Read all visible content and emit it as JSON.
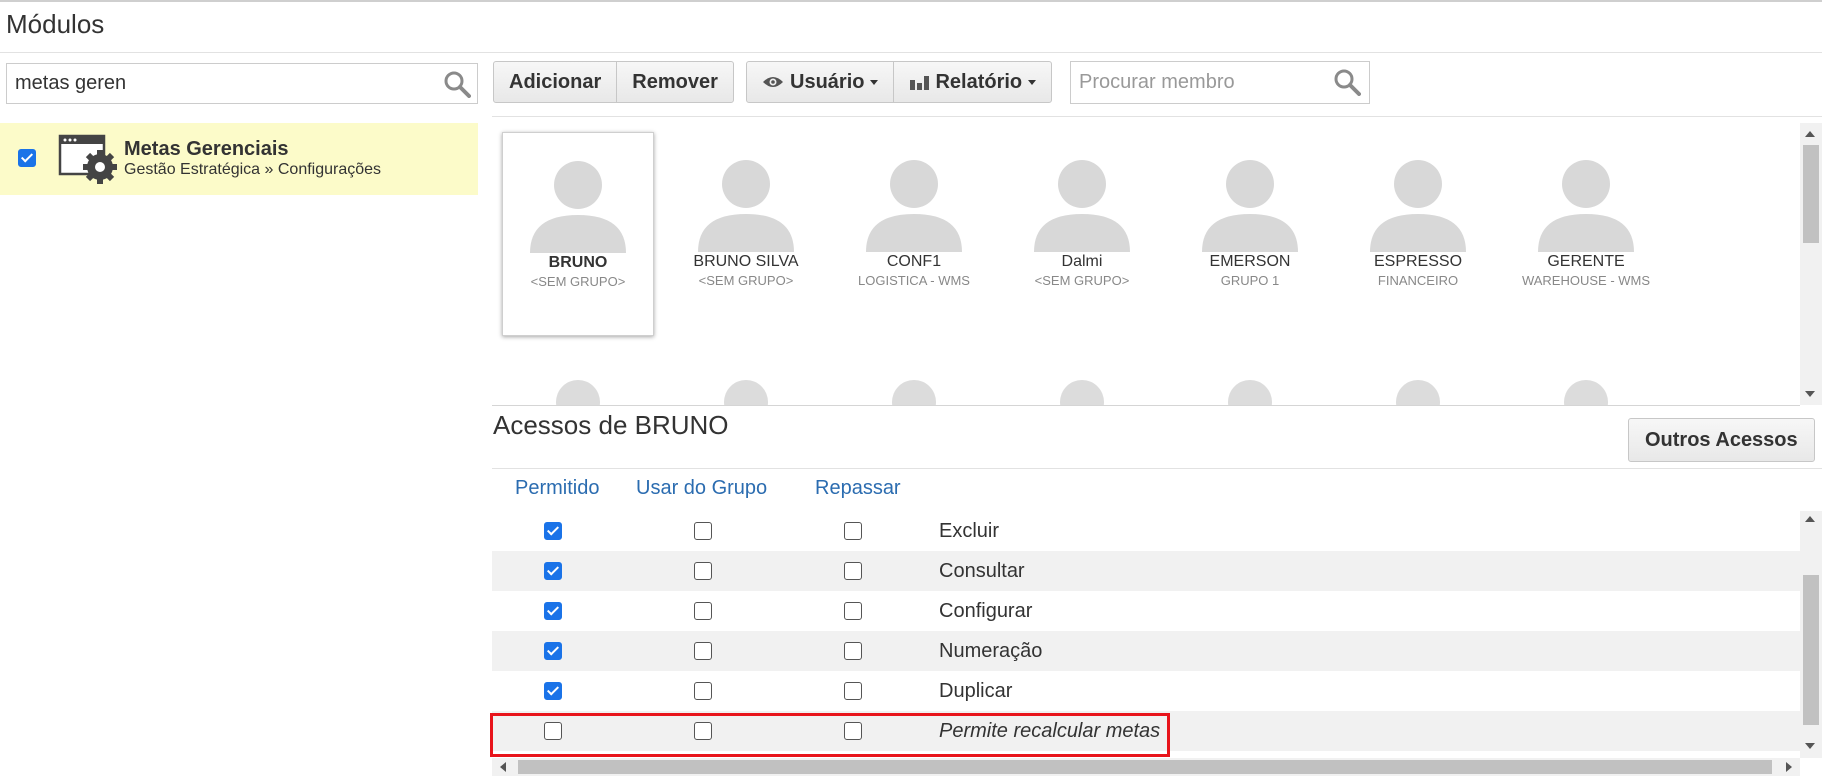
{
  "page_title": "Módulos",
  "module_search": {
    "value": "metas geren",
    "icon": "search-icon"
  },
  "module": {
    "name": "Metas Gerenciais",
    "path": "Gestão Estratégica » Configurações",
    "checked": true,
    "icon": "window-gear-icon"
  },
  "toolbar": {
    "add_label": "Adicionar",
    "remove_label": "Remover",
    "user_label": "Usuário",
    "report_label": "Relatório",
    "member_search_placeholder": "Procurar membro"
  },
  "members": [
    {
      "name": "BRUNO",
      "group": "<SEM GRUPO>",
      "selected": true
    },
    {
      "name": "BRUNO SILVA",
      "group": "<SEM GRUPO>",
      "selected": false
    },
    {
      "name": "CONF1",
      "group": "LOGISTICA - WMS",
      "selected": false
    },
    {
      "name": "Dalmi",
      "group": "<SEM GRUPO>",
      "selected": false
    },
    {
      "name": "EMERSON",
      "group": "GRUPO 1",
      "selected": false
    },
    {
      "name": "ESPRESSO",
      "group": "FINANCEIRO",
      "selected": false
    },
    {
      "name": "GERENTE",
      "group": "WAREHOUSE - WMS",
      "selected": false
    }
  ],
  "access": {
    "title": "Acessos de BRUNO",
    "other_button": "Outros Acessos",
    "columns": [
      "Permitido",
      "Usar do Grupo",
      "Repassar"
    ],
    "rows": [
      {
        "label": "Excluir",
        "permitido": true,
        "usar_grupo": false,
        "repassar": false,
        "italic": false
      },
      {
        "label": "Consultar",
        "permitido": true,
        "usar_grupo": false,
        "repassar": false,
        "italic": false
      },
      {
        "label": "Configurar",
        "permitido": true,
        "usar_grupo": false,
        "repassar": false,
        "italic": false
      },
      {
        "label": "Numeração",
        "permitido": true,
        "usar_grupo": false,
        "repassar": false,
        "italic": false
      },
      {
        "label": "Duplicar",
        "permitido": true,
        "usar_grupo": false,
        "repassar": false,
        "italic": false
      },
      {
        "label": "Permite recalcular metas",
        "permitido": false,
        "usar_grupo": false,
        "repassar": false,
        "italic": true
      }
    ]
  },
  "colors": {
    "highlight": "#e8141b",
    "link": "#2b6cb0",
    "checkbox": "#1a73e8",
    "selected_module_bg": "#fcfbc9"
  }
}
